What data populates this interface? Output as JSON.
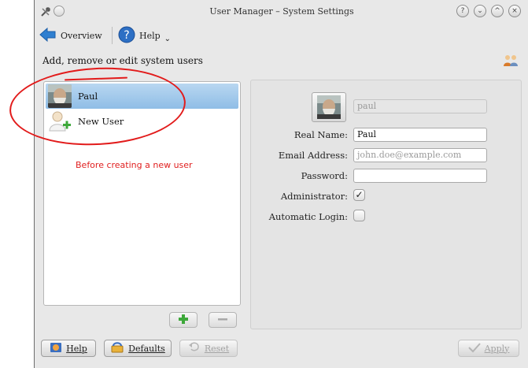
{
  "window": {
    "title": "User Manager – System Settings",
    "controls": [
      "?",
      "⌄",
      "^",
      "×"
    ]
  },
  "toolbar": {
    "overview_label": "Overview",
    "help_label": "Help"
  },
  "page": {
    "subtitle": "Add, remove or edit system users"
  },
  "user_list": {
    "items": [
      {
        "label": "Paul",
        "selected": true,
        "icon": "user-photo"
      },
      {
        "label": "New User",
        "selected": false,
        "icon": "new-user-icon"
      }
    ]
  },
  "details": {
    "username_value": "paul",
    "real_name_label": "Real Name:",
    "real_name_value": "Paul",
    "email_label": "Email Address:",
    "email_placeholder": "john.doe@example.com",
    "password_label": "Password:",
    "password_value": "",
    "administrator_label": "Administrator:",
    "administrator_checked": true,
    "auto_login_label": "Automatic Login:",
    "auto_login_checked": false
  },
  "buttons": {
    "help_label": "Help",
    "defaults_label": "Defaults",
    "reset_label": "Reset",
    "apply_label": "Apply"
  },
  "annotation": {
    "text": "Before creating a new user",
    "color": "#e02020"
  }
}
